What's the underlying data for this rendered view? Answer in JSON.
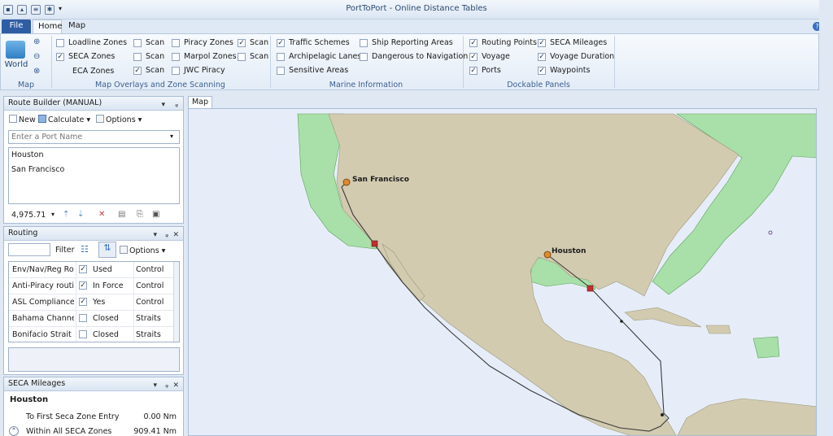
{
  "app": {
    "title": "PortToPort - Online Distance Tables"
  },
  "tabs": {
    "file": "File",
    "home": "Home",
    "map_display": "Map Display"
  },
  "ribbon": {
    "map_group": {
      "world_label": "World",
      "group_label": "Map"
    },
    "overlays": {
      "group_label": "Map Overlays and Zone Scanning",
      "col1": [
        {
          "label": "Loadline Zones",
          "checked": false,
          "scan": "Scan",
          "scan_checked": false
        },
        {
          "label": "SECA Zones",
          "checked": true,
          "scan": "Scan",
          "scan_checked": false
        },
        {
          "label": "ECA Zones",
          "checked": null,
          "scan": "Scan",
          "scan_checked": true
        }
      ],
      "col2": [
        {
          "label": "Piracy Zones",
          "checked": false,
          "scan": "Scan",
          "scan_checked": true
        },
        {
          "label": "Marpol Zones",
          "checked": false,
          "scan": "Scan",
          "scan_checked": false
        },
        {
          "label": "JWC Piracy",
          "checked": false
        }
      ]
    },
    "marine": {
      "group_label": "Marine Information",
      "items": [
        {
          "label": "Traffic Schemes",
          "checked": true
        },
        {
          "label": "Archipelagic Lanes",
          "checked": false
        },
        {
          "label": "Sensitive Areas",
          "checked": false
        },
        {
          "label": "Ship Reporting Areas",
          "checked": false
        },
        {
          "label": "Dangerous to Navigation",
          "checked": false
        }
      ]
    },
    "dockable": {
      "group_label": "Dockable Panels",
      "items": [
        {
          "label": "Routing Points",
          "checked": true
        },
        {
          "label": "Voyage",
          "checked": true
        },
        {
          "label": "Ports",
          "checked": true
        },
        {
          "label": "SECA Mileages",
          "checked": true
        },
        {
          "label": "Voyage Duration",
          "checked": true
        },
        {
          "label": "Waypoints",
          "checked": true
        }
      ]
    }
  },
  "route_builder": {
    "title": "Route Builder (MANUAL)",
    "new_label": "New",
    "calculate_label": "Calculate",
    "options_label": "Options",
    "port_placeholder": "Enter a Port Name",
    "ports": [
      "Houston",
      "San Francisco"
    ],
    "distance": "4,975.71"
  },
  "routing": {
    "title": "Routing",
    "filter_label": "Filter",
    "options_label": "Options",
    "rows": [
      {
        "name": "Env/Nav/Reg Ro",
        "checked": true,
        "status": "Used",
        "type": "Control"
      },
      {
        "name": "Anti-Piracy routi",
        "checked": true,
        "status": "In Force",
        "type": "Control"
      },
      {
        "name": "ASL Compliance",
        "checked": true,
        "status": "Yes",
        "type": "Control"
      },
      {
        "name": "Bahama Channel",
        "checked": false,
        "status": "Closed",
        "type": "Straits"
      },
      {
        "name": "Bonifacio Strait",
        "checked": false,
        "status": "Closed",
        "type": "Straits"
      }
    ]
  },
  "seca": {
    "title": "SECA Mileages",
    "port": "Houston",
    "rows": [
      {
        "label": "To First Seca Zone Entry",
        "value": "0.00 Nm"
      },
      {
        "label": "Within All SECA Zones",
        "value": "909.41 Nm"
      }
    ]
  },
  "map": {
    "tab_label": "Map",
    "labels": {
      "san_francisco": "San Francisco",
      "houston": "Houston"
    },
    "colors": {
      "ocean": "#e6edf8",
      "land": "#d2cbb0",
      "seca": "#a9dfa9",
      "route": "#3a3a3a"
    }
  }
}
